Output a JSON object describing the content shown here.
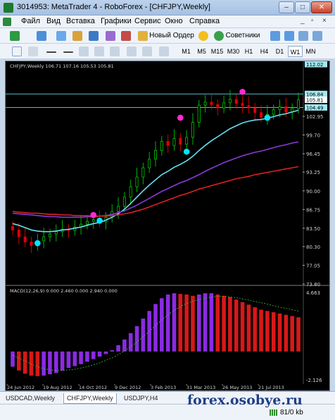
{
  "window": {
    "title": "3014953: MetaTrader 4 - RoboForex - [CHFJPY,Weekly]",
    "controls": [
      "‒",
      "□",
      "✕"
    ]
  },
  "menu": {
    "items": [
      "Файл",
      "Вид",
      "Вставка",
      "Графики",
      "Сервис",
      "Окно",
      "Справка"
    ],
    "mdi_controls": [
      "_",
      "▫",
      "×"
    ]
  },
  "toolbar": {
    "new_order_label": "Новый Ордер",
    "advisors_label": "Советники",
    "timeframes": [
      "M1",
      "M5",
      "M15",
      "M30",
      "H1",
      "H4",
      "D1",
      "W1",
      "MN"
    ],
    "active_timeframe": "W1"
  },
  "chart_data": [
    {
      "type": "candlestick",
      "header": "CHFJPY,Weekly  106.71 107.16 105.53 105.81",
      "price_axis_labels": [
        "112.02",
        "106.84",
        "105.81",
        "104.49",
        "102.95",
        "99.70",
        "96.45",
        "93.25",
        "90.00",
        "86.75",
        "83.50",
        "80.30",
        "77.05",
        "73.80"
      ],
      "ylim": [
        73.8,
        112.02
      ],
      "horizontal_levels": [
        106.84,
        104.49
      ],
      "current_price": 105.81,
      "time_labels": [
        "24 Jun 2012",
        "19 Aug 2012",
        "14 Oct 2012",
        "9 Dec 2012",
        "3 Feb 2013",
        "31 Mar 2013",
        "26 May 2013",
        "21 Jul 2013"
      ],
      "closes": [
        83.2,
        82.0,
        81.1,
        80.5,
        81.3,
        82.0,
        82.5,
        82.9,
        83.3,
        83.1,
        83.7,
        84.2,
        84.7,
        85.0,
        84.6,
        85.4,
        86.4,
        87.3,
        88.9,
        90.7,
        92.4,
        94.0,
        95.5,
        97.0,
        98.6,
        97.9,
        99.1,
        98.1,
        99.3,
        101.9,
        104.9,
        105.4,
        105.0,
        104.4,
        105.3,
        105.9,
        105.2,
        104.8,
        104.4,
        103.6,
        102.8,
        103.3,
        104.1,
        104.6,
        103.7,
        104.3,
        105.81
      ],
      "series": [
        {
          "name": "MA cyan",
          "color": "#66e0f0",
          "values": [
            84.3,
            84.0,
            83.6,
            83.2,
            83.0,
            82.9,
            82.9,
            83.0,
            83.2,
            83.3,
            83.5,
            83.7,
            84.0,
            84.3,
            84.5,
            84.9,
            85.4,
            86.0,
            86.8,
            87.8,
            88.9,
            90.0,
            91.0,
            91.9,
            92.8,
            93.4,
            94.1,
            94.6,
            95.2,
            96.0,
            97.0,
            97.9,
            98.7,
            99.4,
            100.1,
            100.8,
            101.3,
            101.8,
            102.1,
            102.3,
            102.4,
            102.6,
            102.9,
            103.2,
            103.4,
            103.7,
            104.0
          ]
        },
        {
          "name": "MA violet",
          "color": "#8a3ad8",
          "values": [
            86.1,
            86.0,
            85.9,
            85.8,
            85.7,
            85.6,
            85.5,
            85.5,
            85.4,
            85.4,
            85.4,
            85.4,
            85.5,
            85.5,
            85.6,
            85.7,
            85.9,
            86.2,
            86.5,
            87.0,
            87.5,
            88.1,
            88.7,
            89.3,
            89.9,
            90.4,
            90.9,
            91.4,
            91.8,
            92.3,
            92.8,
            93.4,
            93.9,
            94.4,
            94.9,
            95.3,
            95.7,
            96.1,
            96.4,
            96.7,
            96.9,
            97.2,
            97.5,
            97.8,
            98.0,
            98.3,
            98.5
          ]
        },
        {
          "name": "MA red",
          "color": "#e02020",
          "values": [
            86.4,
            86.3,
            86.2,
            86.1,
            86.1,
            86.0,
            85.9,
            85.9,
            85.8,
            85.8,
            85.7,
            85.7,
            85.7,
            85.6,
            85.6,
            85.6,
            85.7,
            85.8,
            86.0,
            86.2,
            86.5,
            86.8,
            87.2,
            87.6,
            88.0,
            88.4,
            88.8,
            89.2,
            89.5,
            89.9,
            90.3,
            90.6,
            90.9,
            91.2,
            91.5,
            91.8,
            92.1,
            92.3,
            92.5,
            92.8,
            93.0,
            93.2,
            93.4,
            93.6,
            93.8,
            94.0,
            94.2
          ]
        }
      ],
      "signals": [
        {
          "index": 4,
          "price": 80.9,
          "color": "#00e5ff"
        },
        {
          "index": 13,
          "price": 85.8,
          "color": "#ff2ccf"
        },
        {
          "index": 14,
          "price": 84.8,
          "color": "#00e5ff"
        },
        {
          "index": 27,
          "price": 102.7,
          "color": "#ff2ccf"
        },
        {
          "index": 28,
          "price": 96.8,
          "color": "#00e5ff"
        },
        {
          "index": 37,
          "price": 107.2,
          "color": "#ff2ccf"
        },
        {
          "index": 41,
          "price": 102.7,
          "color": "#00e5ff"
        }
      ]
    },
    {
      "type": "bar",
      "header": "MACD(12,26,9) 0.000 2.460 0.000 2.940 0.000",
      "axis_labels": [
        "4.663",
        "-2.126"
      ],
      "ylim": [
        -2.126,
        4.663
      ],
      "values": [
        -1.2,
        -1.5,
        -1.75,
        -1.9,
        -1.95,
        -1.9,
        -1.8,
        -1.7,
        -1.5,
        -1.3,
        -1.15,
        -1.0,
        -0.8,
        -0.6,
        -0.4,
        -0.2,
        0.1,
        0.5,
        0.95,
        1.45,
        2.0,
        2.6,
        3.2,
        3.75,
        4.2,
        4.5,
        4.6,
        4.55,
        4.5,
        4.4,
        4.5,
        4.6,
        4.6,
        4.5,
        4.4,
        4.3,
        4.1,
        3.9,
        3.7,
        3.5,
        3.3,
        3.2,
        3.1,
        3.0,
        2.9,
        2.8,
        2.7
      ],
      "signal": [
        -0.3,
        -0.5,
        -0.75,
        -1.0,
        -1.2,
        -1.35,
        -1.45,
        -1.5,
        -1.5,
        -1.45,
        -1.4,
        -1.3,
        -1.2,
        -1.05,
        -0.9,
        -0.7,
        -0.5,
        -0.25,
        0.05,
        0.4,
        0.75,
        1.15,
        1.6,
        2.05,
        2.5,
        2.9,
        3.25,
        3.55,
        3.8,
        3.95,
        4.1,
        4.2,
        4.3,
        4.35,
        4.35,
        4.3,
        4.25,
        4.15,
        4.05,
        3.95,
        3.85,
        3.75,
        3.6,
        3.5,
        3.4,
        3.3,
        3.2
      ],
      "rising_color": "#8a2be2",
      "falling_color": "#d81818"
    }
  ],
  "tabs": {
    "items": [
      "USDCAD,Weekly",
      "CHFJPY,Weekly",
      "USDJPY,H4"
    ],
    "active": "CHFJPY,Weekly"
  },
  "status": {
    "traffic": "81/0 kb"
  },
  "watermark": "forex.osobye.ru"
}
